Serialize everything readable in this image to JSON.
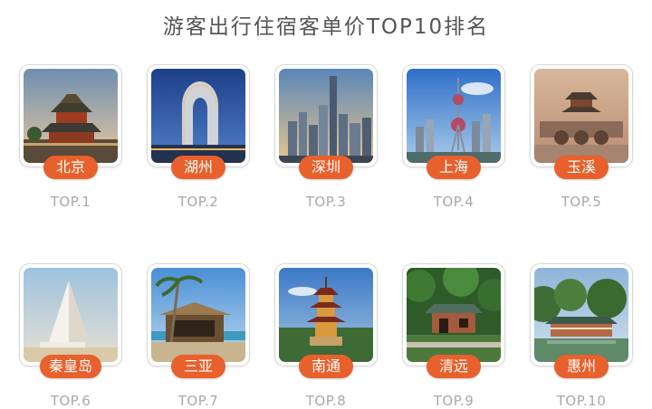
{
  "title": "游客出行住宿客单价TOP10排名",
  "accent_color": "#e8602c",
  "cities": [
    {
      "rank": "TOP.1",
      "name": "北京",
      "image": "forbidden-city-tower"
    },
    {
      "rank": "TOP.2",
      "name": "湖州",
      "image": "horseshoe-hotel"
    },
    {
      "rank": "TOP.3",
      "name": "深圳",
      "image": "skyline"
    },
    {
      "rank": "TOP.4",
      "name": "上海",
      "image": "pearl-tower"
    },
    {
      "rank": "TOP.5",
      "name": "玉溪",
      "image": "pavilion-bridge"
    },
    {
      "rank": "TOP.6",
      "name": "秦皇岛",
      "image": "white-chapel"
    },
    {
      "rank": "TOP.7",
      "name": "三亚",
      "image": "beach-hut"
    },
    {
      "rank": "TOP.8",
      "name": "南通",
      "image": "pagoda"
    },
    {
      "rank": "TOP.9",
      "name": "清远",
      "image": "jungle-pavilion"
    },
    {
      "rank": "TOP.10",
      "name": "惠州",
      "image": "lake-pavilion"
    }
  ]
}
